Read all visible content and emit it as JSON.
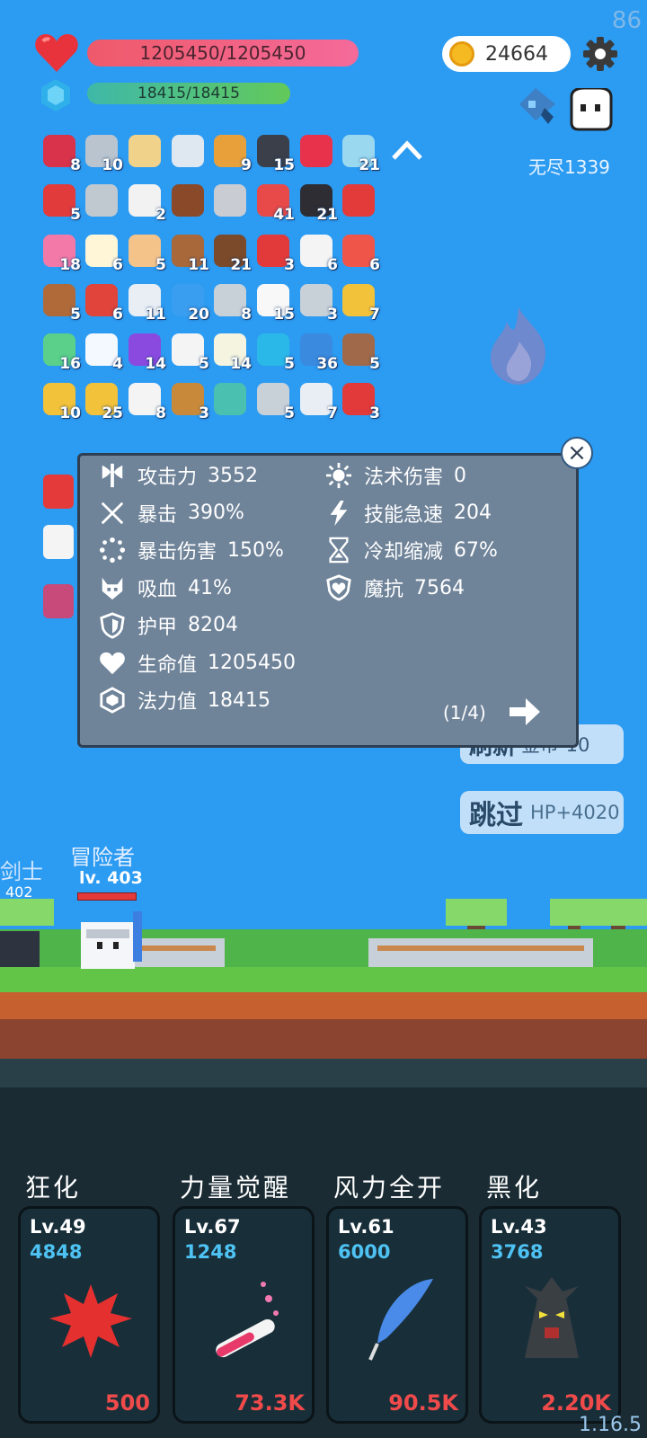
{
  "fps": "86",
  "version": "1.16.5",
  "player": {
    "hp_text": "1205450/1205450",
    "mp_text": "18415/18415",
    "hp_fraction": 1.0,
    "mp_fraction": 1.0,
    "name": "冒险者",
    "level": "lv. 403"
  },
  "currency": {
    "coins": "24664"
  },
  "mode": {
    "endless": "无尽1339"
  },
  "enemy": {
    "name": "剑士",
    "level": "402"
  },
  "inventory": [
    {
      "icon": "jam-jar-icon",
      "count": "8",
      "color": "#d8334a"
    },
    {
      "icon": "sword-icon",
      "count": "10",
      "color": "#b9c4cf"
    },
    {
      "icon": "treasure-map-icon",
      "count": "",
      "color": "#f1d28a"
    },
    {
      "icon": "great-sword-icon",
      "count": "",
      "color": "#dfe8f0"
    },
    {
      "icon": "book-icon",
      "count": "9",
      "color": "#e8a13a"
    },
    {
      "icon": "bat-icon",
      "count": "15",
      "color": "#3a3f4a"
    },
    {
      "icon": "ruby-icon",
      "count": "",
      "color": "#e8314a"
    },
    {
      "icon": "magic-orb-icon",
      "count": "21",
      "color": "#9ad8f0"
    },
    {
      "icon": "mushroom-icon",
      "count": "5",
      "color": "#e23b3b"
    },
    {
      "icon": "mace-icon",
      "count": "",
      "color": "#c0c8d0"
    },
    {
      "icon": "dice-icon",
      "count": "2",
      "color": "#f2f2f2"
    },
    {
      "icon": "brown-mushroom-icon",
      "count": "",
      "color": "#8a4a2a"
    },
    {
      "icon": "viking-helmet-icon",
      "count": "",
      "color": "#c9ccd2"
    },
    {
      "icon": "watermelon-icon",
      "count": "41",
      "color": "#e84a4a"
    },
    {
      "icon": "cauldron-icon",
      "count": "21",
      "color": "#2d2d33"
    },
    {
      "icon": "magnet-icon",
      "count": "",
      "color": "#e33a3a"
    },
    {
      "icon": "ice-cream-icon",
      "count": "18",
      "color": "#f37aa8"
    },
    {
      "icon": "fried-egg-icon",
      "count": "6",
      "color": "#fff6d8"
    },
    {
      "icon": "fist-icon",
      "count": "5",
      "color": "#f4c38a"
    },
    {
      "icon": "shield-round-icon",
      "count": "11",
      "color": "#a8683a"
    },
    {
      "icon": "coconut-icon",
      "count": "21",
      "color": "#7a4a2a"
    },
    {
      "icon": "apple-icon",
      "count": "3",
      "color": "#e23a3a"
    },
    {
      "icon": "playing-card-icon",
      "count": "6",
      "color": "#f4f4f4"
    },
    {
      "icon": "gift-box-icon",
      "count": "6",
      "color": "#f0554a"
    },
    {
      "icon": "cake-flag-icon",
      "count": "5",
      "color": "#b06a3a"
    },
    {
      "icon": "sock-icon",
      "count": "6",
      "color": "#e0443a"
    },
    {
      "icon": "envelope-icon",
      "count": "11",
      "color": "#e8eef4"
    },
    {
      "icon": "chat-bubble-icon",
      "count": "20",
      "color": "#3a9ef0"
    },
    {
      "icon": "battle-axe-icon",
      "count": "8",
      "color": "#c8d0d8"
    },
    {
      "icon": "ghost-icon",
      "count": "15",
      "color": "#f8f8f8"
    },
    {
      "icon": "compass-icon",
      "count": "3",
      "color": "#c8d0d8"
    },
    {
      "icon": "ring-icon",
      "count": "7",
      "color": "#f2c23a"
    },
    {
      "icon": "green-slime-icon",
      "count": "16",
      "color": "#5ad08a"
    },
    {
      "icon": "angel-wings-icon",
      "count": "4",
      "color": "#f4f8ff"
    },
    {
      "icon": "magic-hat-icon",
      "count": "14",
      "color": "#8a4ae0"
    },
    {
      "icon": "flower-icon",
      "count": "5",
      "color": "#f4f4f4"
    },
    {
      "icon": "lightbulb-icon",
      "count": "14",
      "color": "#f4f4e0"
    },
    {
      "icon": "sapphire-icon",
      "count": "5",
      "color": "#2ab8e8"
    },
    {
      "icon": "star-photo-icon",
      "count": "36",
      "color": "#3a8ae0"
    },
    {
      "icon": "door-icon",
      "count": "5",
      "color": "#a06a4a"
    },
    {
      "icon": "magic-wand-icon",
      "count": "10",
      "color": "#f2c23a"
    },
    {
      "icon": "crown-icon",
      "count": "25",
      "color": "#f2c23a"
    },
    {
      "icon": "cloud-icon",
      "count": "8",
      "color": "#f4f4f4"
    },
    {
      "icon": "bow-icon",
      "count": "3",
      "color": "#c88a3a"
    },
    {
      "icon": "target-icon",
      "count": "",
      "color": "#4ac0b0"
    },
    {
      "icon": "meteor-icon",
      "count": "5",
      "color": "#c8d0d8"
    },
    {
      "icon": "hook-icon",
      "count": "7",
      "color": "#e8eef4"
    },
    {
      "icon": "potion-icon",
      "count": "3",
      "color": "#e23a3a"
    }
  ],
  "stats": {
    "left": [
      {
        "icon": "axe-icon",
        "label": "攻击力",
        "value": "3552"
      },
      {
        "icon": "crit-icon",
        "label": "暴击",
        "value": "390%"
      },
      {
        "icon": "crit-damage-icon",
        "label": "暴击伤害",
        "value": "150%"
      },
      {
        "icon": "lifesteal-icon",
        "label": "吸血",
        "value": "41%"
      },
      {
        "icon": "armor-icon",
        "label": "护甲",
        "value": "8204"
      },
      {
        "icon": "heart-stat-icon",
        "label": "生命值",
        "value": "1205450"
      },
      {
        "icon": "mana-icon",
        "label": "法力值",
        "value": "18415"
      }
    ],
    "right": [
      {
        "icon": "sun-icon",
        "label": "法术伤害",
        "value": "0"
      },
      {
        "icon": "lightning-icon",
        "label": "技能急速",
        "value": "204"
      },
      {
        "icon": "hourglass-icon",
        "label": "冷却缩减",
        "value": "67%"
      },
      {
        "icon": "magic-resist-icon",
        "label": "魔抗",
        "value": "7564"
      }
    ],
    "page": "(1/4)"
  },
  "actions": {
    "refresh_label": "刷新",
    "refresh_cost": "金币-10",
    "skip_label": "跳过",
    "skip_reward": "HP+4020"
  },
  "skills": [
    {
      "title": "狂化",
      "level": "Lv.49",
      "power": "4848",
      "cost": "500",
      "icon": "rage-splat-icon"
    },
    {
      "title": "力量觉醒",
      "level": "Lv.67",
      "power": "1248",
      "cost": "73.3K",
      "icon": "potion-tube-icon"
    },
    {
      "title": "风力全开",
      "level": "Lv.61",
      "power": "6000",
      "cost": "90.5K",
      "icon": "feather-icon"
    },
    {
      "title": "黑化",
      "level": "Lv.43",
      "power": "3768",
      "cost": "2.20K",
      "icon": "dark-tree-icon"
    }
  ]
}
